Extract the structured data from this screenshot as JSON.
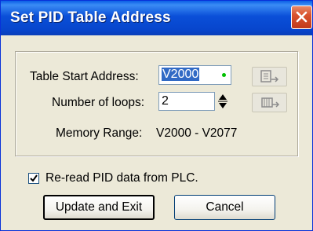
{
  "window": {
    "title": "Set PID Table Address"
  },
  "table_start": {
    "label": "Table Start Address:",
    "value": "V2000"
  },
  "loops": {
    "label": "Number of loops:",
    "value": "2"
  },
  "memory_range": {
    "label": "Memory Range:",
    "value": "V2000 - V2077"
  },
  "reread": {
    "label": "Re-read PID data from PLC.",
    "checked": true
  },
  "buttons": {
    "update": "Update and Exit",
    "cancel": "Cancel"
  },
  "icons": [
    "close-icon",
    "read-table-icon",
    "write-table-icon",
    "spinner-up-icon",
    "spinner-down-icon",
    "checkmark-icon"
  ]
}
